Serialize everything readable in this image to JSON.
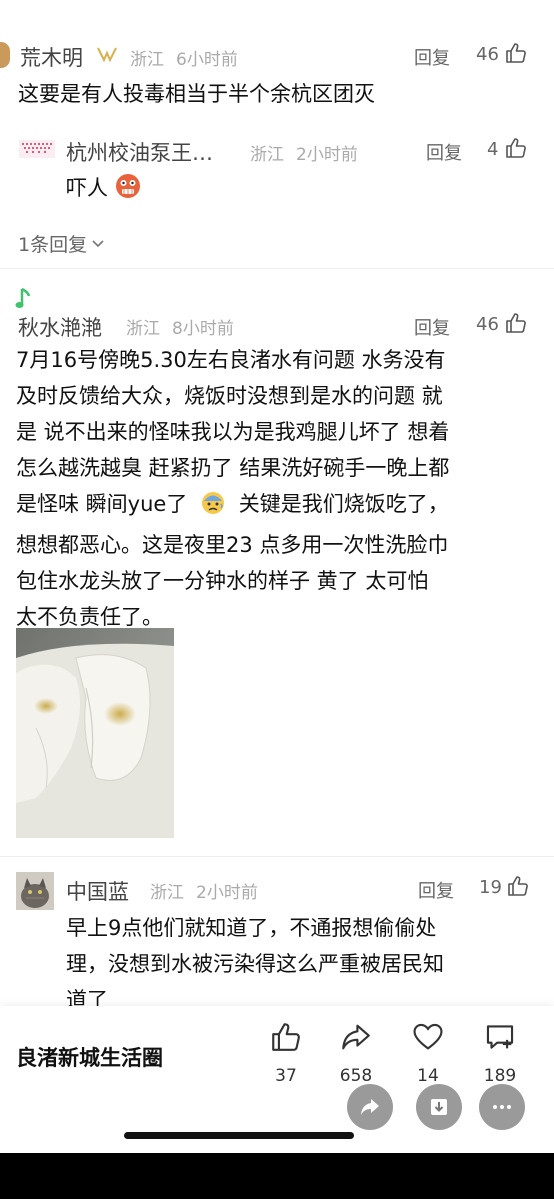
{
  "comments": [
    {
      "name": "荒木明",
      "location": "浙江",
      "time": "6小时前",
      "reply": "回复",
      "likes": "46",
      "text": "这要是有人投毒相当于半个余杭区团灭"
    },
    {
      "name": "杭州校油泵王…",
      "location": "浙江",
      "time": "2小时前",
      "reply": "回复",
      "likes": "4",
      "text": "吓人"
    },
    {
      "name": "秋水滟滟",
      "location": "浙江",
      "time": "8小时前",
      "reply": "回复",
      "likes": "46",
      "lines": [
        "7月16号傍晚5.30左右良渚水有问题 水务没有",
        "及时反馈给大众，烧饭时没想到是水的问题  就",
        "是 说不出来的怪味我以为是我鸡腿儿坏了 想着",
        "怎么越洗越臭 赶紧扔了 结果洗好碗手一晚上都",
        "是怪味  瞬间yue了",
        "想想都恶心。这是夜里23 点多用一次性洗脸巾",
        "包住水龙头放了一分钟水的样子 黄了  太可怕",
        "太不负责任了。"
      ],
      "line5_tail": "关键是我们烧饭吃了，"
    },
    {
      "name": "中国蓝",
      "location": "浙江",
      "time": "2小时前",
      "reply": "回复",
      "likes": "19",
      "lines": [
        "早上9点他们就知道了，不通报想偷偷处",
        "理，没想到水被污染得这么严重被居民知",
        "道了"
      ]
    }
  ],
  "replies_toggle": "1条回复",
  "bottom_bar": {
    "circle_name": "良渚新城生活圈",
    "like_count": "37",
    "share_count": "658",
    "fav_count": "14",
    "comment_count": "189"
  }
}
